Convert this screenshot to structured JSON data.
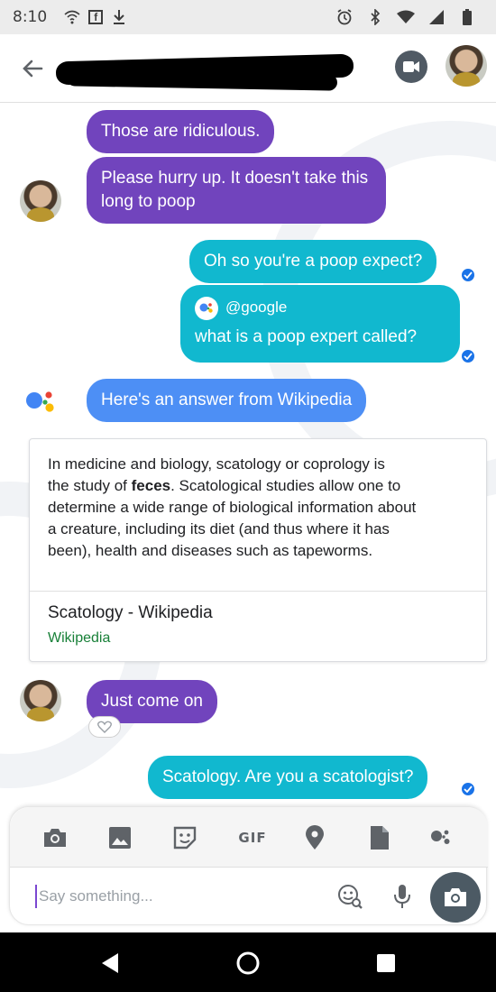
{
  "status_bar": {
    "time": "8:10",
    "icons": [
      "wifi-icon",
      "facebook-icon",
      "download-icon",
      "alarm-icon",
      "bluetooth-icon",
      "wifi-signal-icon",
      "cell-signal-icon",
      "battery-icon"
    ]
  },
  "header": {
    "back_icon": "arrow-back-icon",
    "contact_name": "",
    "video_icon": "video-call-icon"
  },
  "messages": [
    {
      "id": "m1",
      "sender": "contact",
      "text": "Those are ridiculous."
    },
    {
      "id": "m2",
      "sender": "contact",
      "text_lines": [
        "Please hurry up. It doesn't take this",
        "long to poop"
      ]
    },
    {
      "id": "m3",
      "sender": "me",
      "text": "Oh so you're a poop expect?"
    },
    {
      "id": "m4",
      "sender": "me",
      "mention": "@google",
      "text": "what is a poop expert called?"
    },
    {
      "id": "m5",
      "sender": "assistant",
      "text": "Here's an answer from Wikipedia"
    },
    {
      "id": "m6",
      "sender": "contact",
      "text": "Just come on"
    },
    {
      "id": "m7",
      "sender": "me",
      "text": "Scatology. Are you a scatologist?"
    }
  ],
  "wiki_card": {
    "line1": "In medicine and biology, scatology or coprology is",
    "line2_before": "the study of ",
    "line2_bold": "feces",
    "line2_after": ". Scatological studies allow one to",
    "line3": "determine a wide range of biological information about",
    "line4": "a creature, including its diet (and thus where it has",
    "line5": "been), health and diseases such as tapeworms.",
    "title": "Scatology - Wikipedia",
    "source": "Wikipedia"
  },
  "compose": {
    "toolbar": {
      "gif_label": "GIF",
      "icons": [
        "camera-icon",
        "gallery-icon",
        "sticker-icon",
        "gif-icon",
        "location-icon",
        "file-icon",
        "assistant-icon"
      ]
    },
    "placeholder": "Say something..."
  },
  "colors": {
    "contact_bubble": "#7144bd",
    "my_bubble": "#11b8cf",
    "assistant_bubble": "#4d8ff5",
    "read_check": "#1a73e8",
    "wiki_source": "#188038"
  }
}
